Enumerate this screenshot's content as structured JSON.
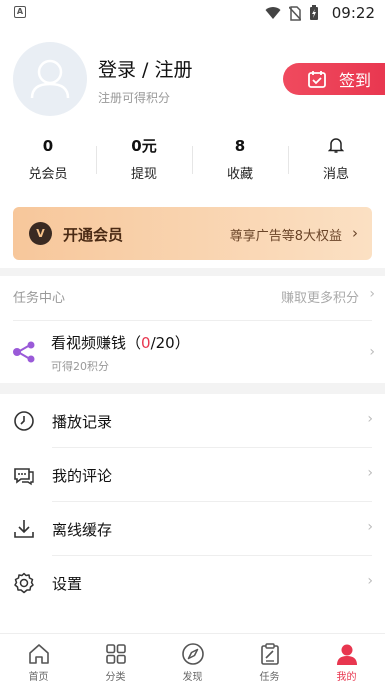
{
  "status_bar": {
    "time": "09:22",
    "badge": "A"
  },
  "profile": {
    "title": "登录 / 注册",
    "subtitle": "注册可得积分",
    "checkin_label": "签到"
  },
  "stats": [
    {
      "value": "0",
      "label": "兑会员"
    },
    {
      "value": "0元",
      "label": "提现"
    },
    {
      "value": "8",
      "label": "收藏"
    },
    {
      "value": "",
      "label": "消息"
    }
  ],
  "vip": {
    "logo": "V",
    "title": "开通会员",
    "benefits": "尊享广告等8大权益"
  },
  "task_center": {
    "header": "任务中心",
    "more": "赚取更多积分",
    "task": {
      "title_prefix": "看视频赚钱（",
      "done": "0",
      "title_suffix": "/20）",
      "subtitle": "可得20积分"
    }
  },
  "menu": [
    {
      "label": "播放记录",
      "icon": "clock-icon"
    },
    {
      "label": "我的评论",
      "icon": "comment-icon"
    },
    {
      "label": "离线缓存",
      "icon": "download-icon"
    },
    {
      "label": "设置",
      "icon": "gear-icon"
    }
  ],
  "nav": [
    {
      "label": "首页",
      "icon": "home-icon"
    },
    {
      "label": "分类",
      "icon": "grid-icon"
    },
    {
      "label": "发现",
      "icon": "compass-icon"
    },
    {
      "label": "任务",
      "icon": "clipboard-icon"
    },
    {
      "label": "我的",
      "icon": "user-icon",
      "active": true
    }
  ],
  "colors": {
    "accent": "#e8364f",
    "vip_start": "#f7c79b",
    "vip_end": "#fbe0c3"
  }
}
